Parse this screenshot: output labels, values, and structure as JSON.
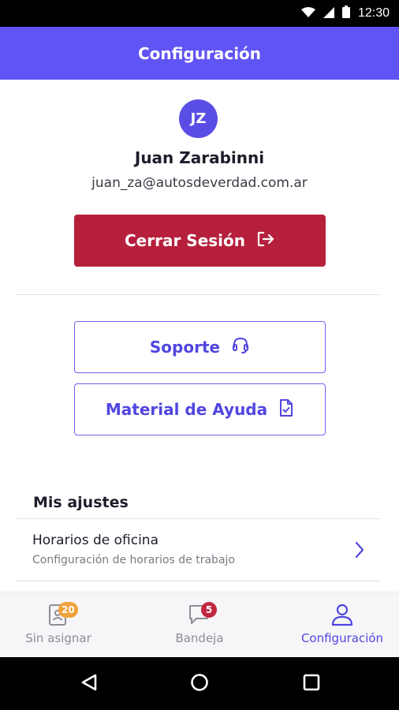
{
  "status_bar": {
    "time": "12:30"
  },
  "app_bar": {
    "title": "Configuración"
  },
  "profile": {
    "initials": "JZ",
    "name": "Juan Zarabinni",
    "email": "juan_za@autosdeverdad.com.ar"
  },
  "actions": {
    "logout_label": "Cerrar Sesión",
    "support_label": "Soporte",
    "help_label": "Material de Ayuda"
  },
  "settings": {
    "section_title": "Mis ajustes",
    "items": [
      {
        "title": "Horarios de oficina",
        "subtitle": "Configuración de horarios de trabajo"
      }
    ]
  },
  "bottom_nav": {
    "items": [
      {
        "label": "Sin asignar",
        "badge": "20",
        "icon": "assignment-icon"
      },
      {
        "label": "Bandeja",
        "badge": "5",
        "icon": "chat-icon"
      },
      {
        "label": "Configuración",
        "badge": "",
        "icon": "person-icon"
      }
    ],
    "active_index": 2
  },
  "colors": {
    "primary": "#6154f5",
    "danger": "#b6203c",
    "accent_text": "#5146e0",
    "badge_orange": "#f0a23a",
    "badge_red": "#c2283f"
  }
}
